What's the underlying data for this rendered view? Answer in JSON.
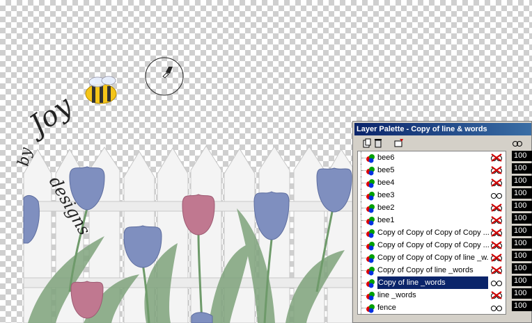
{
  "palette": {
    "title": "Layer Palette - Copy of line & words",
    "layers": [
      {
        "name": "bee6",
        "visible": false
      },
      {
        "name": "bee5",
        "visible": false
      },
      {
        "name": "bee4",
        "visible": false
      },
      {
        "name": "bee3",
        "visible": true
      },
      {
        "name": "bee2",
        "visible": false
      },
      {
        "name": "bee1",
        "visible": false
      },
      {
        "name": "Copy of Copy of Copy of Copy ...",
        "visible": false
      },
      {
        "name": "Copy of Copy of Copy of Copy ...",
        "visible": false
      },
      {
        "name": "Copy of Copy of Copy of line _w...",
        "visible": false
      },
      {
        "name": "Copy of Copy of line _words",
        "visible": false
      },
      {
        "name": "Copy of line _words",
        "visible": true,
        "selected": true
      },
      {
        "name": "line _words",
        "visible": false
      },
      {
        "name": "fence",
        "visible": true
      }
    ],
    "opacities": [
      "100",
      "100",
      "100",
      "100",
      "100",
      "100",
      "100",
      "100",
      "100",
      "100",
      "100",
      "100",
      "100"
    ]
  },
  "canvas": {
    "script_text": "by Joy  designs"
  },
  "colors": {
    "title_start": "#0a246a",
    "title_end": "#3a6ea5",
    "selection": "#0a246a",
    "panel": "#d4d0c8"
  }
}
